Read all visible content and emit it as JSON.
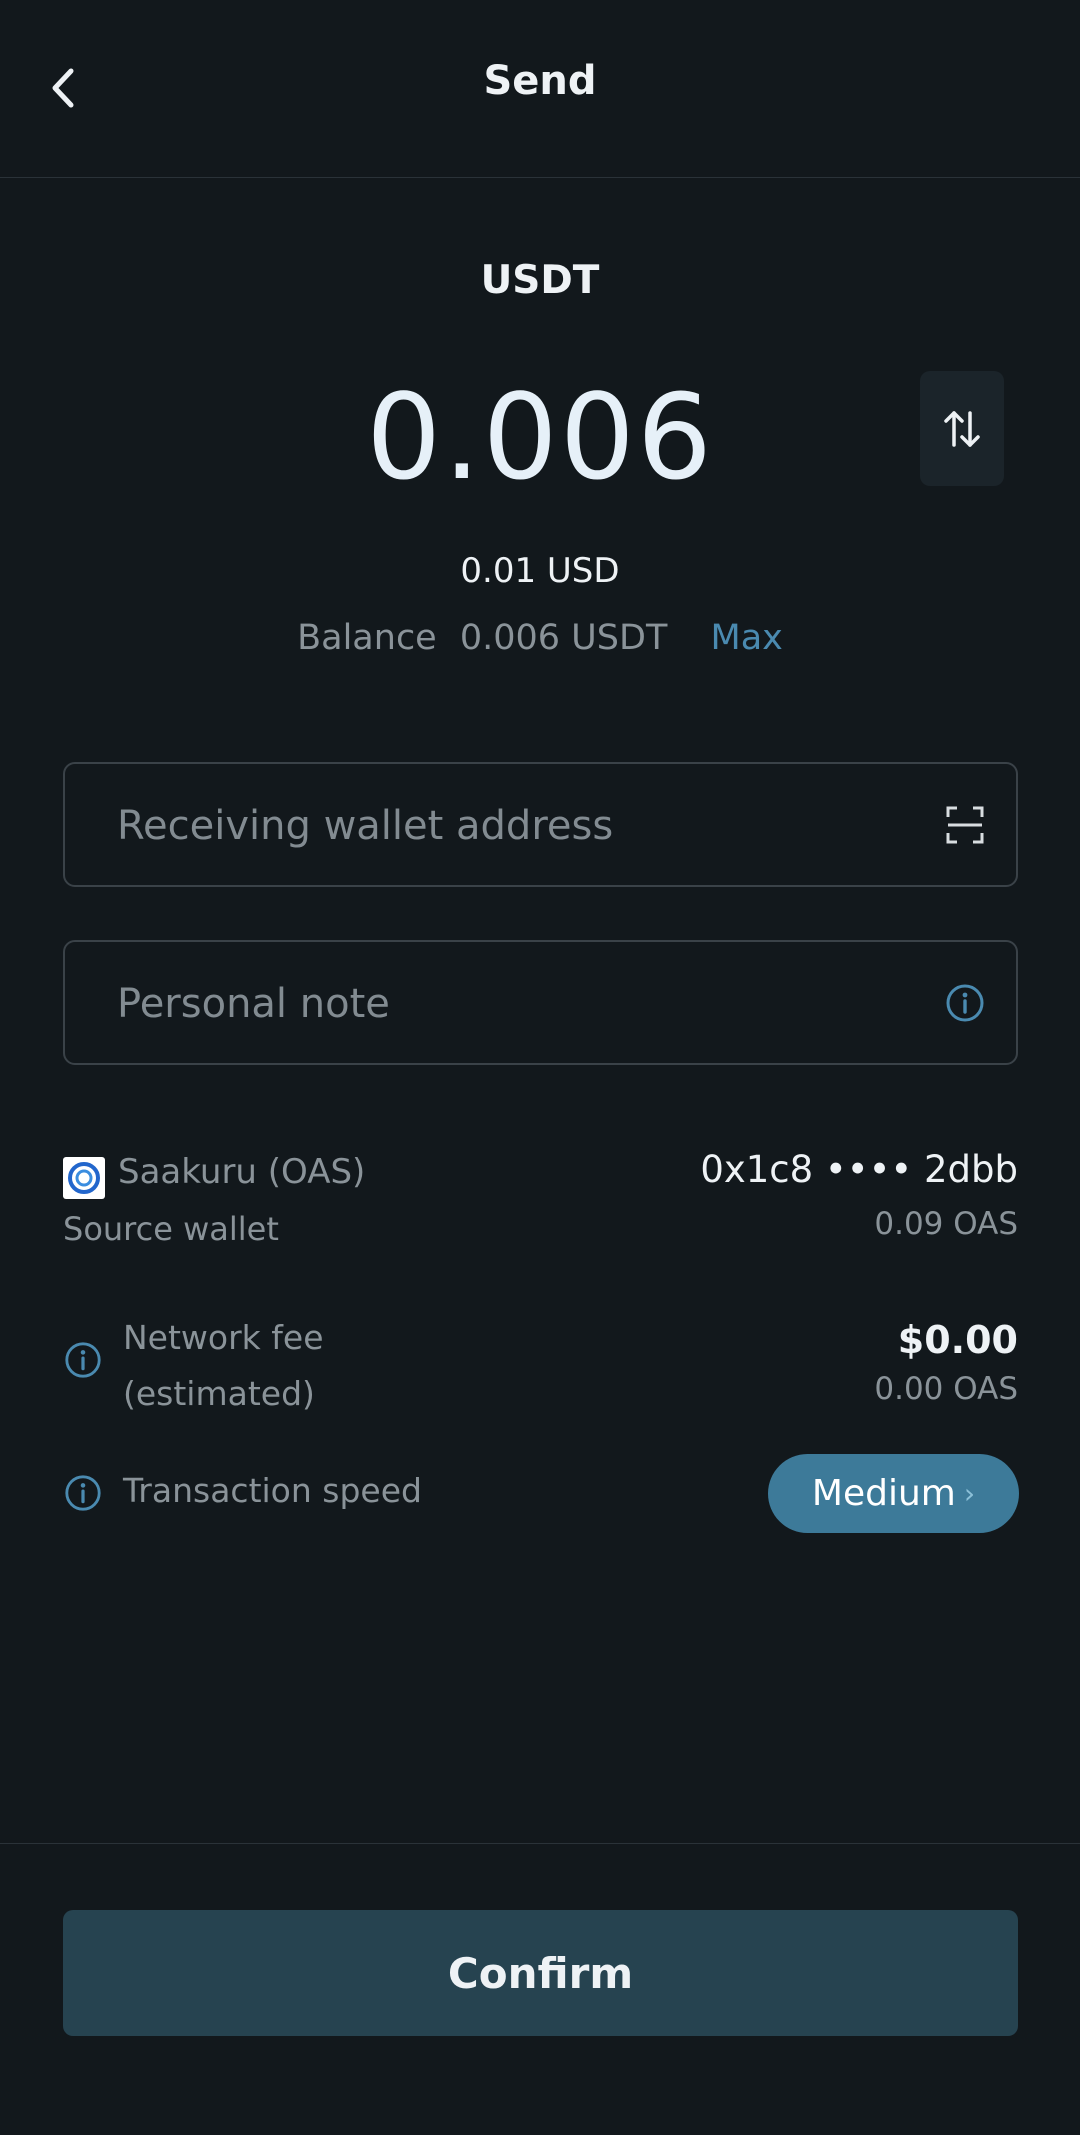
{
  "header": {
    "title": "Send"
  },
  "token": {
    "symbol": "USDT"
  },
  "amount": {
    "value": "0.006",
    "usd": "0.01 USD"
  },
  "balance": {
    "label": "Balance",
    "value": "0.006 USDT",
    "max_label": "Max"
  },
  "inputs": {
    "address_placeholder": "Receiving wallet address",
    "note_placeholder": "Personal note"
  },
  "wallet": {
    "name": "Saakuru (OAS)",
    "sub": "Source wallet",
    "address": "0x1c8 •••• 2dbb",
    "balance": "0.09 OAS"
  },
  "fee": {
    "label_line1": "Network fee",
    "label_line2": "(estimated)",
    "usd": "$0.00",
    "oas": "0.00 OAS"
  },
  "speed": {
    "label": "Transaction speed",
    "value": "Medium"
  },
  "footer": {
    "confirm_label": "Confirm"
  },
  "colors": {
    "accent": "#4a8ab0",
    "pill": "#3d7a99",
    "confirm": "#264350",
    "background": "#12181c"
  }
}
